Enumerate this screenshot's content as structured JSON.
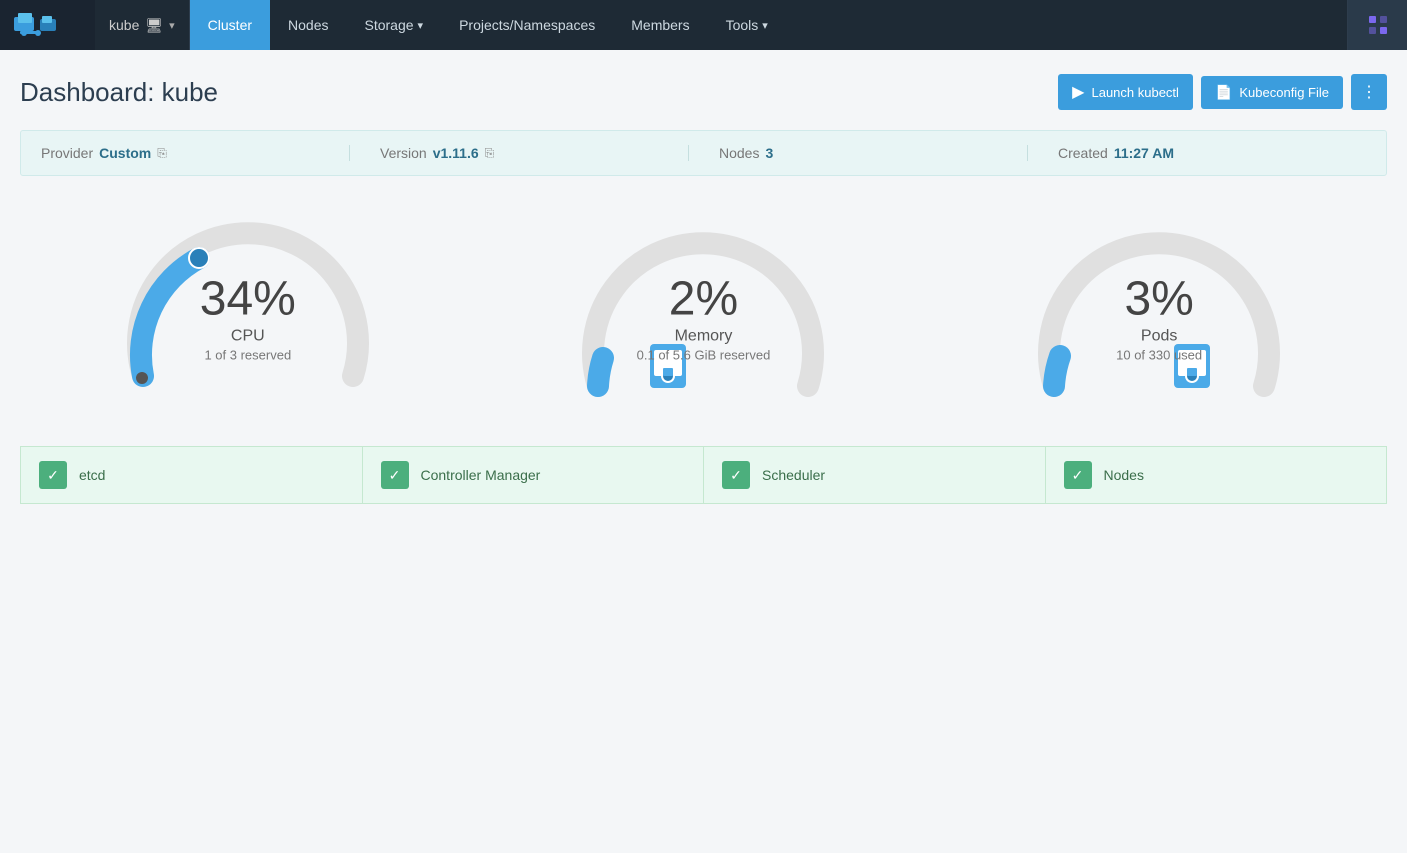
{
  "brand": {
    "cluster_name": "kube",
    "cluster_icon": "🖥"
  },
  "navbar": {
    "items": [
      {
        "id": "cluster",
        "label": "Cluster",
        "active": true,
        "has_dropdown": false
      },
      {
        "id": "nodes",
        "label": "Nodes",
        "active": false,
        "has_dropdown": false
      },
      {
        "id": "storage",
        "label": "Storage",
        "active": false,
        "has_dropdown": true
      },
      {
        "id": "projects",
        "label": "Projects/Namespaces",
        "active": false,
        "has_dropdown": false
      },
      {
        "id": "members",
        "label": "Members",
        "active": false,
        "has_dropdown": false
      },
      {
        "id": "tools",
        "label": "Tools",
        "active": false,
        "has_dropdown": true
      }
    ]
  },
  "header": {
    "title": "Dashboard: kube",
    "launch_kubectl_label": "Launch kubectl",
    "kubeconfig_label": "Kubeconfig File",
    "more_label": "⋮"
  },
  "info_bar": {
    "provider_label": "Provider",
    "provider_value": "Custom",
    "version_label": "Version",
    "version_value": "v1.11.6",
    "nodes_label": "Nodes",
    "nodes_value": "3",
    "created_label": "Created",
    "created_value": "11:27 AM"
  },
  "gauges": [
    {
      "id": "cpu",
      "percent": "34%",
      "label": "CPU",
      "sublabel": "1 of 3 reserved",
      "value": 34,
      "color": "#4baae8",
      "bg_color": "#dde"
    },
    {
      "id": "memory",
      "percent": "2%",
      "label": "Memory",
      "sublabel": "0.1 of 5.6 GiB reserved",
      "value": 2,
      "color": "#4baae8",
      "bg_color": "#dde"
    },
    {
      "id": "pods",
      "percent": "3%",
      "label": "Pods",
      "sublabel": "10 of 330 used",
      "value": 3,
      "color": "#4baae8",
      "bg_color": "#dde"
    }
  ],
  "status_cards": [
    {
      "id": "etcd",
      "label": "etcd"
    },
    {
      "id": "controller-manager",
      "label": "Controller Manager"
    },
    {
      "id": "scheduler",
      "label": "Scheduler"
    },
    {
      "id": "nodes",
      "label": "Nodes"
    }
  ]
}
